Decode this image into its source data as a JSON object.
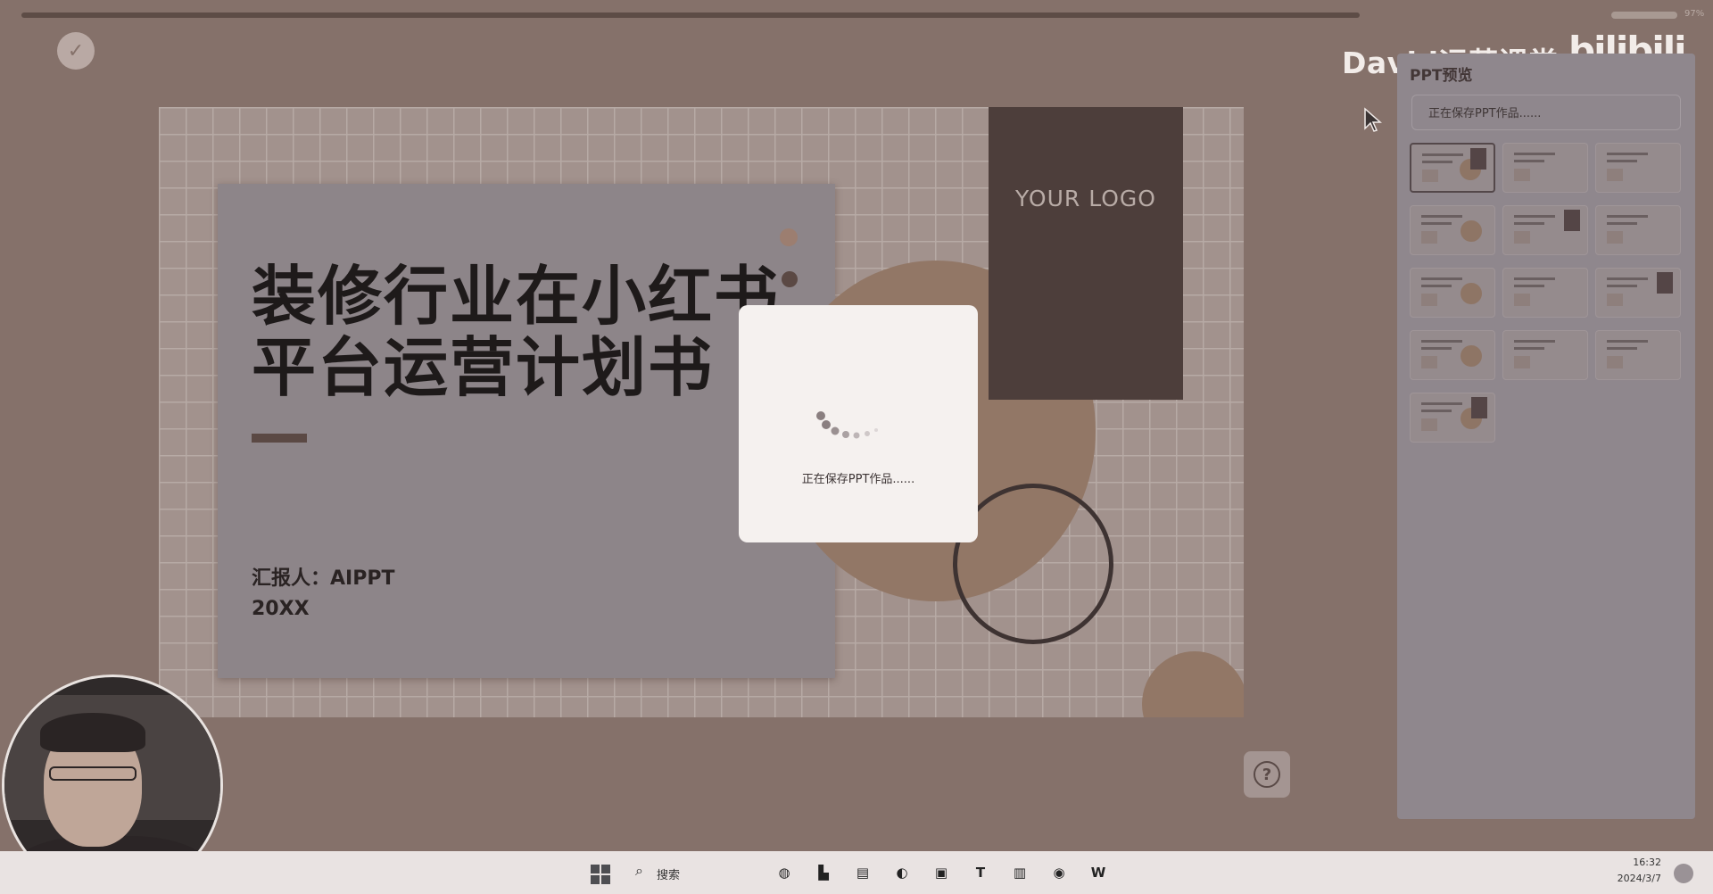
{
  "top_bar": {
    "zoom_text": "97%"
  },
  "watermark": {
    "channel": "David运营课堂",
    "platform": "bilibili"
  },
  "slide": {
    "title": "装修行业在小红书平台运营计划书",
    "reporter": "汇报人：AIPPT",
    "year": "20XX",
    "logo_text": "YOUR LOGO"
  },
  "modal": {
    "status": "正在保存PPT作品......"
  },
  "preview_panel": {
    "title": "PPT预览",
    "status": "正在保存PPT作品......",
    "thumbnail_count": 13
  },
  "help": {
    "icon": "question-icon",
    "glyph": "?"
  },
  "taskbar": {
    "search_label": "搜索",
    "time": "16:32",
    "date": "2024/3/7",
    "apps": [
      {
        "name": "widgets-icon",
        "glyph": "◍"
      },
      {
        "name": "taskview-icon",
        "glyph": "▙"
      },
      {
        "name": "file-explorer-icon",
        "glyph": "▤"
      },
      {
        "name": "edge-icon",
        "glyph": "◐"
      },
      {
        "name": "store-icon",
        "glyph": "▣"
      },
      {
        "name": "typora-icon",
        "glyph": "T"
      },
      {
        "name": "notepad-icon",
        "glyph": "▥"
      },
      {
        "name": "chrome-icon",
        "glyph": "◉"
      },
      {
        "name": "word-icon",
        "glyph": "W"
      }
    ]
  },
  "colors": {
    "background": "#85716a",
    "accent_brown": "#927766",
    "logo_block": "#4d3e3b",
    "modal": "#f5f1ef"
  }
}
